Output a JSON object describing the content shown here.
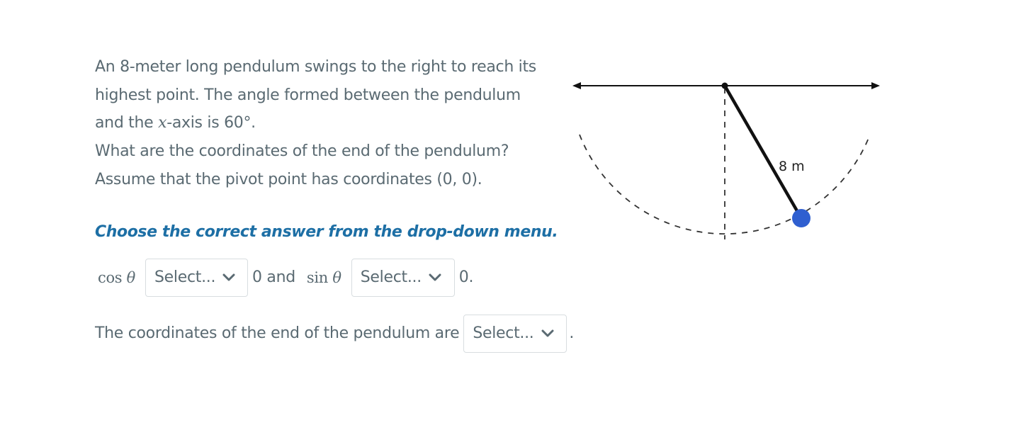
{
  "question": {
    "line1": "An 8-meter long pendulum swings to the right to reach its",
    "line2": "highest point. The angle formed between the pendulum",
    "line3_pre": "and the ",
    "line3_var": "x",
    "line3_post": "-axis is 60°.",
    "line4": "What are the coordinates of the end of the pendulum?",
    "line5": "Assume that the pivot point has coordinates (0, 0)."
  },
  "instruction": "Choose the correct answer from the drop-down menu.",
  "row1": {
    "cos_label": "cos",
    "theta": "θ",
    "select1_value": "Select...",
    "between": "0 and",
    "sin_label": "sin",
    "select2_value": "Select...",
    "end": "0."
  },
  "row2": {
    "text": "The coordinates of the end of the pendulum are",
    "select3_value": "Select...",
    "end": "."
  },
  "figure": {
    "length_label": "8 m",
    "angle_deg": 60,
    "bob_color": "#2f5fd0",
    "rod_color": "#111111"
  },
  "colors": {
    "text": "#5a6a72",
    "instruction": "#1d6fa5"
  }
}
